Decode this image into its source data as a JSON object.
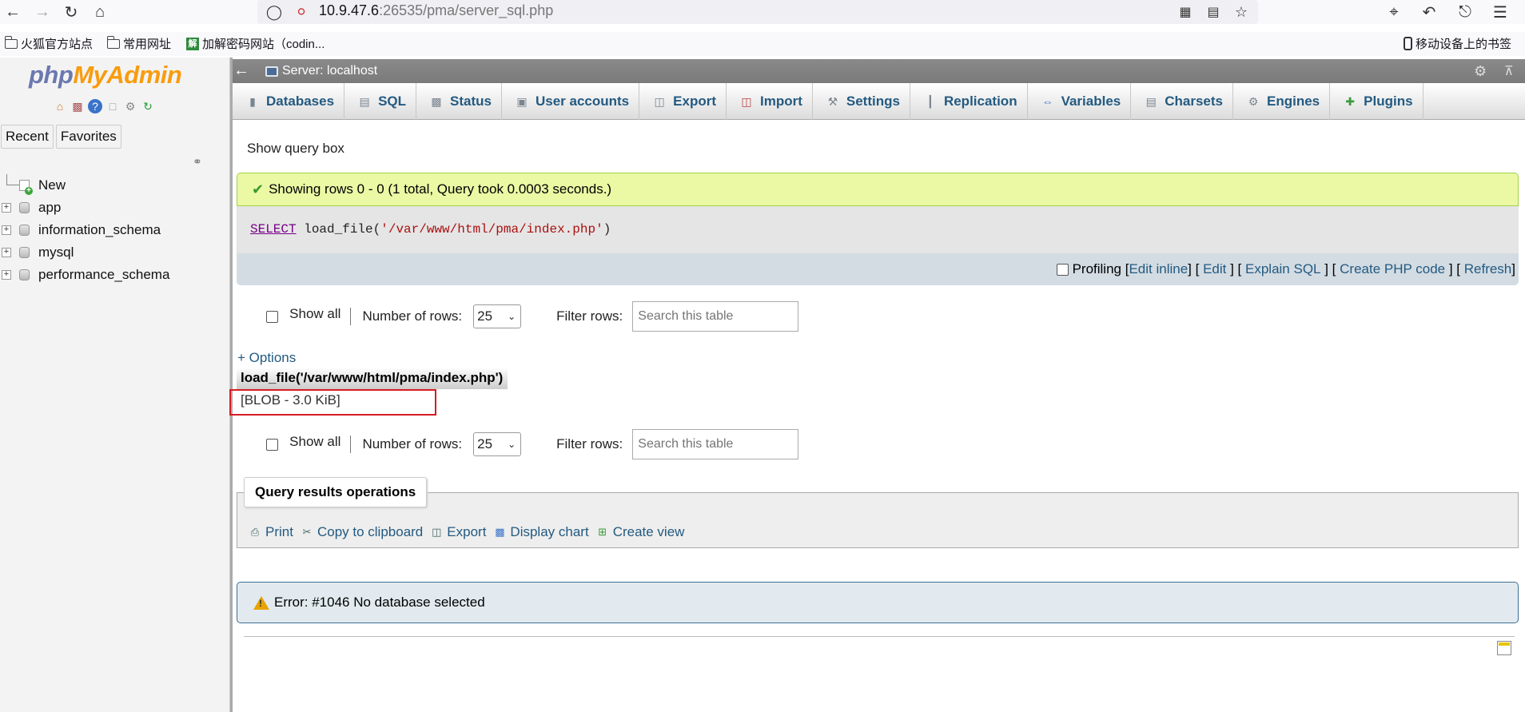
{
  "browser": {
    "url_host": "10.9.47.6",
    "url_rest": ":26535/pma/server_sql.php",
    "bookmarks": [
      {
        "label": "火狐官方站点"
      },
      {
        "label": "常用网址"
      },
      {
        "label": "加解密码网站（codin..."
      }
    ],
    "mobile_bookmarks": "移动设备上的书签"
  },
  "nav": {
    "logo_php": "php",
    "logo_myadmin": "MyAdmin",
    "tabs": {
      "recent": "Recent",
      "favorites": "Favorites"
    },
    "tree": {
      "new": "New",
      "databases": [
        "app",
        "information_schema",
        "mysql",
        "performance_schema"
      ]
    }
  },
  "serverbar": {
    "label": "Server: localhost"
  },
  "menu": {
    "tabs": [
      {
        "label": "Databases",
        "icon": "database-icon"
      },
      {
        "label": "SQL",
        "icon": "sql-icon"
      },
      {
        "label": "Status",
        "icon": "status-icon"
      },
      {
        "label": "User accounts",
        "icon": "users-icon"
      },
      {
        "label": "Export",
        "icon": "export-icon"
      },
      {
        "label": "Import",
        "icon": "import-icon"
      },
      {
        "label": "Settings",
        "icon": "wrench-icon"
      },
      {
        "label": "Replication",
        "icon": "replication-icon"
      },
      {
        "label": "Variables",
        "icon": "variables-icon"
      },
      {
        "label": "Charsets",
        "icon": "charsets-icon"
      },
      {
        "label": "Engines",
        "icon": "engines-icon"
      },
      {
        "label": "Plugins",
        "icon": "plugins-icon"
      }
    ]
  },
  "content": {
    "show_query_box": "Show query box",
    "success_message": "Showing rows 0 - 0 (1 total, Query took 0.0003 seconds.)",
    "sql": {
      "keyword": "SELECT",
      "func": " load_file(",
      "arg": "'/var/www/html/pma/index.php'",
      "close": ")"
    },
    "profiling": {
      "label": "Profiling",
      "edit_inline": "Edit inline",
      "edit": "Edit",
      "explain_sql": "Explain SQL",
      "create_php_code": "Create PHP code",
      "refresh": "Refresh"
    },
    "table_nav": {
      "show_all": "Show all",
      "number_of_rows_label": "Number of rows:",
      "rows_value": "25",
      "filter_label": "Filter rows:",
      "filter_placeholder": "Search this table"
    },
    "options_link": "+ Options",
    "result": {
      "column_header": "load_file('/var/www/html/pma/index.php')",
      "cell_value": "[BLOB - 3.0 KiB]"
    },
    "operations": {
      "legend": "Query results operations",
      "links": {
        "print": "Print",
        "copy": "Copy to clipboard",
        "export": "Export",
        "chart": "Display chart",
        "view": "Create view"
      }
    },
    "error_message": "Error: #1046 No database selected"
  }
}
